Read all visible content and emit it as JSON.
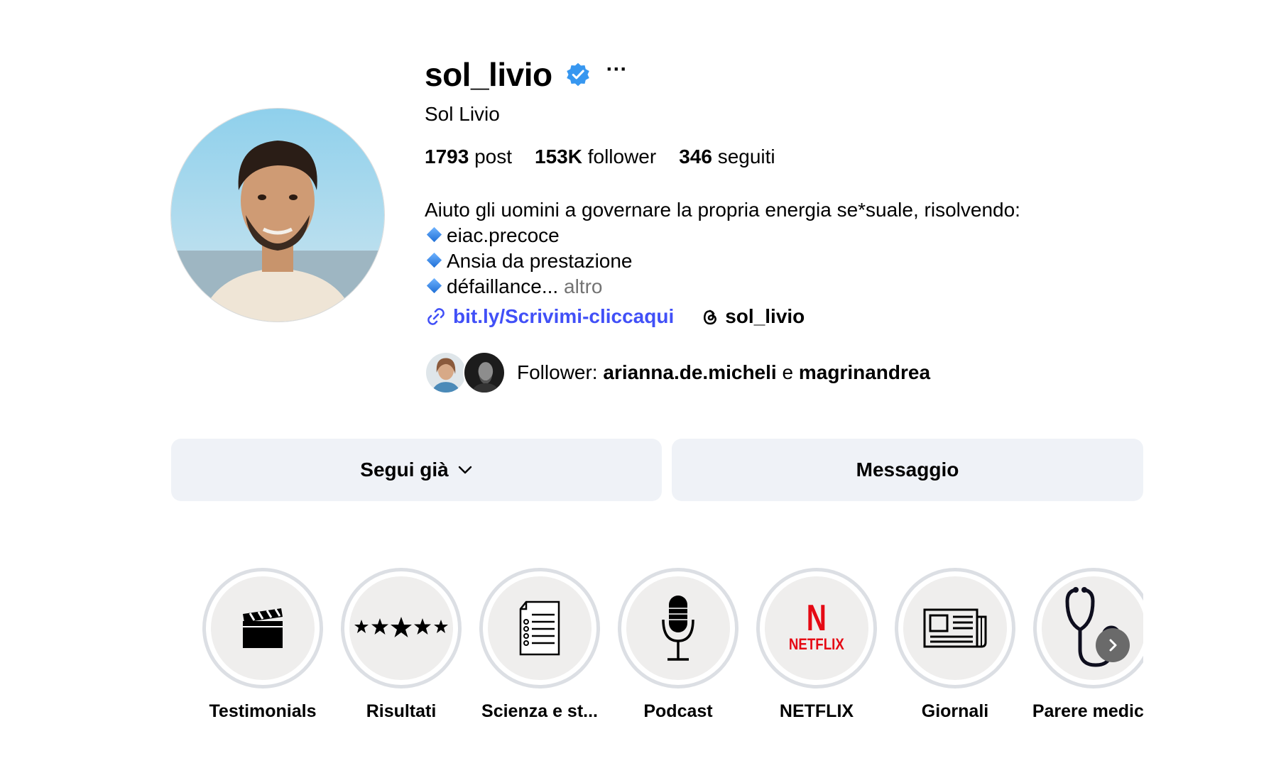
{
  "profile": {
    "username": "sol_livio",
    "more": "···",
    "full_name": "Sol Livio",
    "stats": {
      "posts_value": "1793",
      "posts_label": " post",
      "followers_value": "153K",
      "followers_label": " follower",
      "following_value": "346",
      "following_label": " seguiti"
    },
    "bio": {
      "line1": "Aiuto gli uomini a governare la propria energia se*suale, risolvendo:",
      "line2": "eiac.precoce",
      "line3": "Ansia da prestazione",
      "line4": "défaillance...",
      "more": " altro"
    },
    "link_text": "bit.ly/Scrivimi-cliccaqui",
    "threads_handle": "sol_livio",
    "followed_by": {
      "prefix": "Follower: ",
      "user1": "arianna.de.micheli",
      "conj": " e ",
      "user2": "magrinandrea"
    }
  },
  "buttons": {
    "follow": "Segui già",
    "message": "Messaggio"
  },
  "highlights": [
    {
      "label": "Testimonials",
      "icon": "clapperboard-icon"
    },
    {
      "label": "Risultati",
      "icon": "stars-icon"
    },
    {
      "label": "Scienza e st...",
      "icon": "document-icon"
    },
    {
      "label": "Podcast",
      "icon": "microphone-icon"
    },
    {
      "label": "NETFLIX",
      "icon": "netflix-icon",
      "logo_letter": "N",
      "logo_word": "NETFLIX"
    },
    {
      "label": "Giornali",
      "icon": "newspaper-icon"
    },
    {
      "label": "Parere medico",
      "icon": "stethoscope-icon"
    }
  ],
  "colors": {
    "link": "#4150f7",
    "verified": "#3797f0",
    "button_bg": "#eff2f7",
    "netflix_red": "#e50914"
  }
}
